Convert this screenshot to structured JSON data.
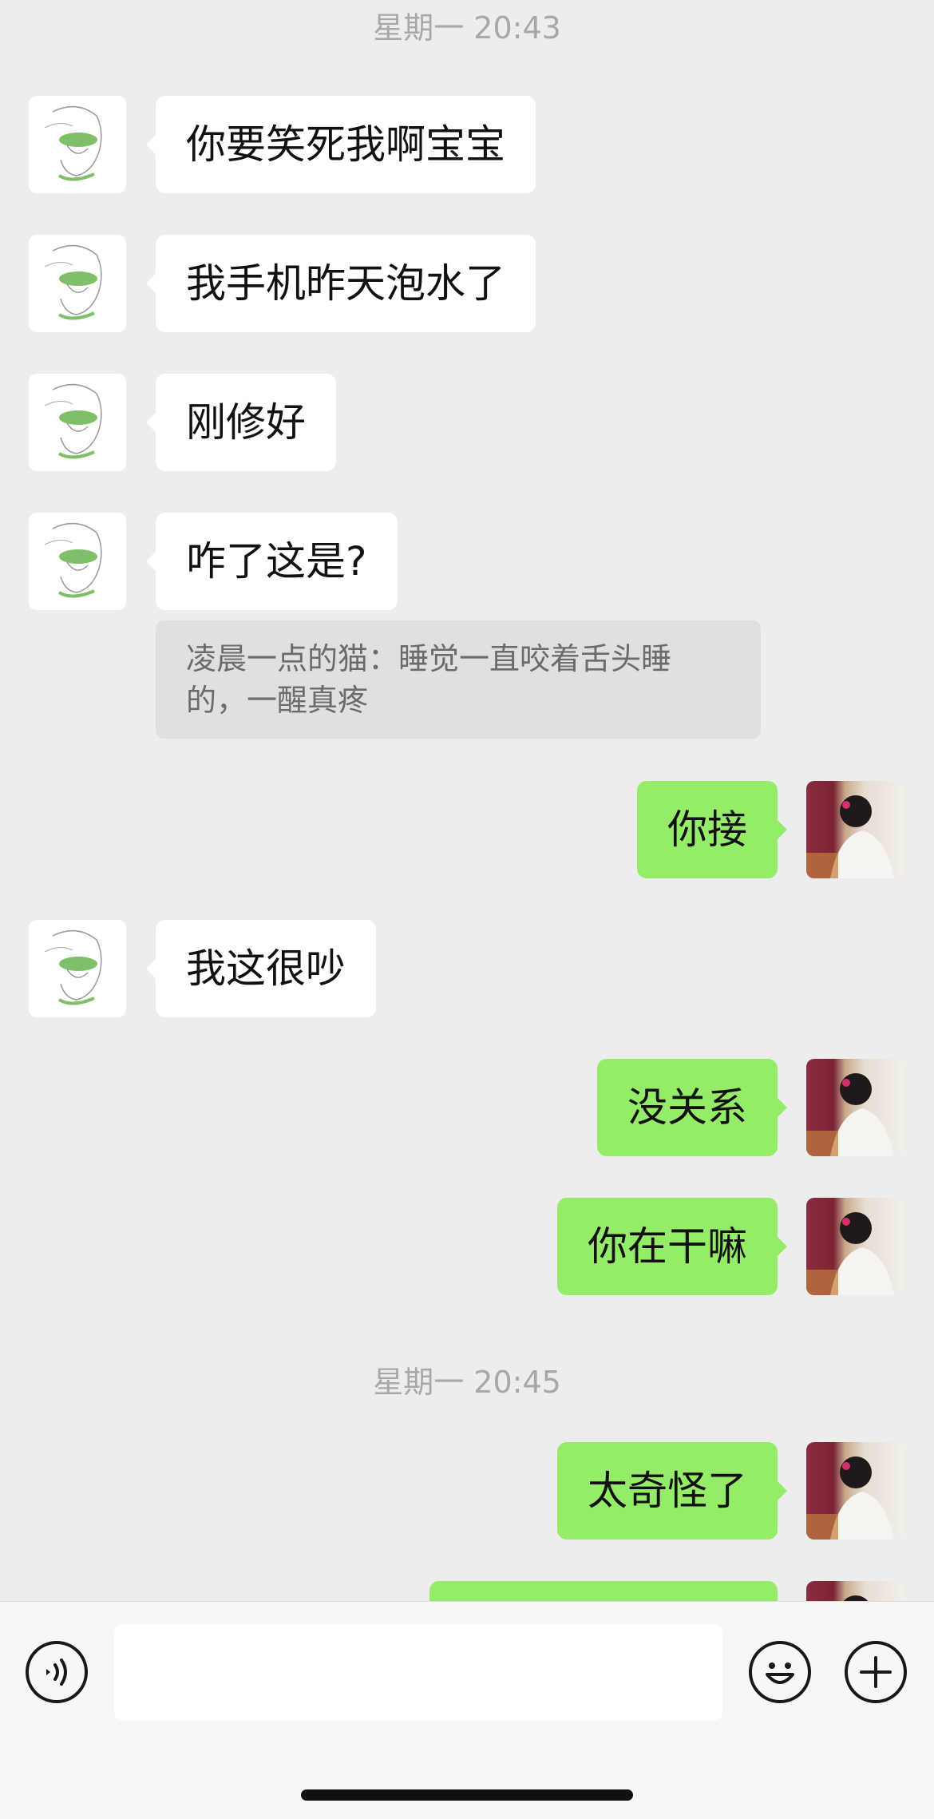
{
  "timestamps": [
    "星期一 20:43",
    "星期一 20:45"
  ],
  "messages": [
    {
      "from": "contact",
      "text": "你要笑死我啊宝宝"
    },
    {
      "from": "contact",
      "text": "我手机昨天泡水了"
    },
    {
      "from": "contact",
      "text": "刚修好"
    },
    {
      "from": "contact",
      "text": "咋了这是?"
    },
    {
      "from": "me",
      "text": "你接"
    },
    {
      "from": "contact",
      "text": "我这很吵"
    },
    {
      "from": "me",
      "text": "没关系"
    },
    {
      "from": "me",
      "text": "你在干嘛"
    },
    {
      "from": "me",
      "text": "太奇怪了"
    },
    {
      "from": "me",
      "text": ""
    }
  ],
  "quoted_reply": {
    "sender": "凌晨一点的猫",
    "line1": "凌晨一点的猫：睡觉一直咬着舌头睡",
    "line2": "的，一醒真疼"
  },
  "input_bar": {
    "input_value": "",
    "voice_icon": "voice-icon",
    "emoji_icon": "emoji-icon",
    "plus_icon": "plus-icon"
  },
  "colors": {
    "background": "#ededed",
    "outgoing_bubble": "#95ec69",
    "incoming_bubble": "#ffffff",
    "timestamp_text": "#a8a8a8"
  }
}
